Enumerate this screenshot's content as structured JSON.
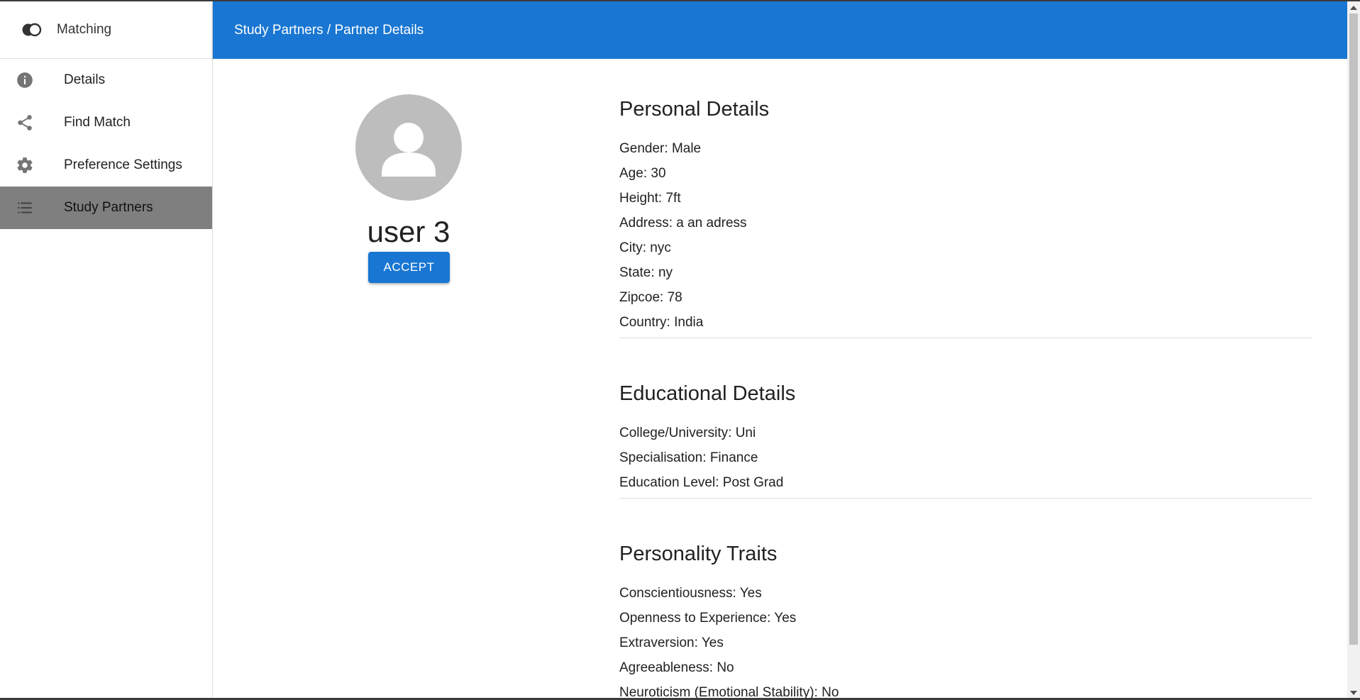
{
  "sidebar": {
    "brand": {
      "icon": "overlapping-circles-logo",
      "label": "Matching"
    },
    "items": [
      {
        "label": "Details",
        "icon": "info-icon",
        "active": false
      },
      {
        "label": "Find Match",
        "icon": "share-icon",
        "active": false
      },
      {
        "label": "Preference Settings",
        "icon": "gear-icon",
        "active": false
      },
      {
        "label": "Study Partners",
        "icon": "list-icon",
        "active": true
      }
    ]
  },
  "appbar": {
    "breadcrumb": "Study Partners / Partner Details",
    "color": "#1976d2"
  },
  "profile": {
    "avatar_icon": "person-icon",
    "name": "user 3",
    "accept_label": "ACCEPT"
  },
  "sections": {
    "personal": {
      "title": "Personal Details",
      "fields": [
        {
          "label": "Gender",
          "value": "Male"
        },
        {
          "label": "Age",
          "value": "30"
        },
        {
          "label": "Height",
          "value": "7ft"
        },
        {
          "label": "Address",
          "value": "a an adress"
        },
        {
          "label": "City",
          "value": "nyc"
        },
        {
          "label": "State",
          "value": "ny"
        },
        {
          "label": "Zipcoe",
          "value": "78"
        },
        {
          "label": "Country",
          "value": "India"
        }
      ]
    },
    "education": {
      "title": "Educational Details",
      "fields": [
        {
          "label": "College/University",
          "value": "Uni"
        },
        {
          "label": "Specialisation",
          "value": "Finance"
        },
        {
          "label": "Education Level",
          "value": "Post Grad"
        }
      ]
    },
    "personality": {
      "title": "Personality Traits",
      "fields": [
        {
          "label": "Conscientiousness",
          "value": "Yes"
        },
        {
          "label": "Openness to Experience",
          "value": "Yes"
        },
        {
          "label": "Extraversion",
          "value": "Yes"
        },
        {
          "label": "Agreeableness",
          "value": "No"
        },
        {
          "label": "Neuroticism (Emotional Stability)",
          "value": "No"
        }
      ]
    }
  }
}
